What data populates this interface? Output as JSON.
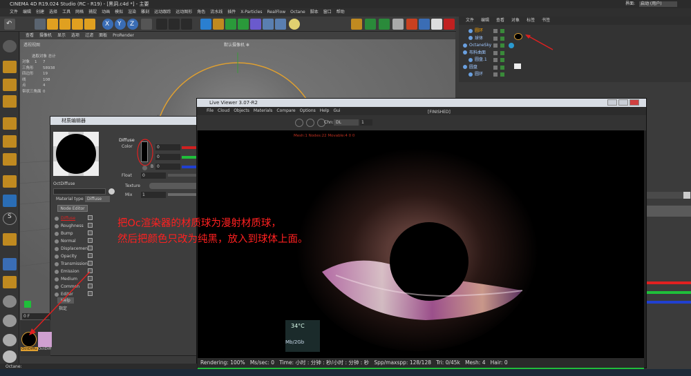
{
  "app": {
    "title": "CINEMA 4D R19.024 Studio (RC - R19) - [黑洞.c4d *] - 主要",
    "layout_label": "界面:",
    "layout_value": "启动 (用户)"
  },
  "main_menu": [
    "文件",
    "编辑",
    "创建",
    "选择",
    "工具",
    "网格",
    "捕捉",
    "动画",
    "模拟",
    "渲染",
    "雕刻",
    "运动跟踪",
    "运动图形",
    "角色",
    "流水线",
    "插件",
    "X-Particles",
    "RealFlow",
    "Octane",
    "脚本",
    "窗口",
    "帮助"
  ],
  "viewport": {
    "menu": [
      "查看",
      "摄像机",
      "显示",
      "选项",
      "过滤",
      "面板",
      "ProRender"
    ],
    "name": "透视视图",
    "camera": "默认摄像机 ✻",
    "stats_header": "选取对象 总计",
    "stats": [
      {
        "label": "对象",
        "a": "1",
        "b": "7"
      },
      {
        "label": "三角形",
        "a": "",
        "b": "58938"
      },
      {
        "label": "四边形",
        "a": "",
        "b": "19"
      },
      {
        "label": "线",
        "a": "",
        "b": "108"
      },
      {
        "label": "点",
        "a": "",
        "b": "4"
      },
      {
        "label": "带状三角面",
        "a": "",
        "b": "0"
      }
    ]
  },
  "object_manager": {
    "menu": [
      "文件",
      "编辑",
      "查看",
      "对象",
      "标签",
      "书签"
    ],
    "objects": [
      {
        "name": "圆环",
        "indent": 1
      },
      {
        "name": "球体",
        "indent": 1
      },
      {
        "name": "OctaneSky",
        "indent": 0
      },
      {
        "name": "布料曲面",
        "indent": 0
      },
      {
        "name": "圆盘.1",
        "indent": 1
      },
      {
        "name": "圆盘",
        "indent": 0
      },
      {
        "name": "圆环",
        "indent": 1
      }
    ]
  },
  "material_editor": {
    "title": "材质编辑器",
    "material_name": "OctDiffuse",
    "material_type_label": "Material type",
    "material_type_value": "Diffuse",
    "node_editor_label": "Node Editor",
    "channels": [
      "Diffuse",
      "Roughness",
      "Bump",
      "Normal",
      "Displacement",
      "Opacity",
      "Transmission",
      "Emission",
      "Medium",
      "Common",
      "Editor"
    ],
    "help_label": "Help",
    "assign_label": "指定",
    "section": "Diffuse",
    "color_label": "Color",
    "r_value": "0",
    "g_value": "0",
    "b_value": "0",
    "b_letter": "B",
    "float_label": "Float",
    "float_value": "0",
    "texture_label": "Texture",
    "mix_label": "Mix",
    "mix_value": "1"
  },
  "live_viewer": {
    "title": "Live Viewer 3.07-R2",
    "menu": [
      "File",
      "Cloud",
      "Objects",
      "Materials",
      "Compare",
      "Options",
      "Help",
      "Gui"
    ],
    "finished": "[FINISHED]",
    "channel_label": "Chn:",
    "channel_value": "DL",
    "channel_num": "1",
    "mesh_info": "Mesh:1 Nodes:22 Movable:4  0 0",
    "status": {
      "rendering": "Rendering: 100%",
      "ms_sec": "Ms/sec: 0",
      "time": "Time: 小时 : 分钟 : 秒/小时 : 分钟 : 秒",
      "spp": "Spp/maxspp: 128/128",
      "tri": "Tri: 0/45k",
      "mesh": "Mesh: 4",
      "hair": "Hair: 0"
    },
    "temp": "34°C",
    "gpu_mem": "Mb/2Gb"
  },
  "material_slots": [
    {
      "name": "OctDiffu",
      "selected": true
    },
    {
      "name": "OctDiff",
      "selected": false
    }
  ],
  "annotation": {
    "line1": "把Oc渲染器的材质球为漫射材质球，",
    "line2": "然后把颜色只改为纯黑，放入到球体上面。",
    "color": "#ff2020"
  },
  "colors": {
    "accent_red": "#e02020",
    "accent_green": "#1fbf3a",
    "accent_blue": "#2040d0",
    "highlight_orange": "#ffa500"
  },
  "bottom_label": "Octane:"
}
